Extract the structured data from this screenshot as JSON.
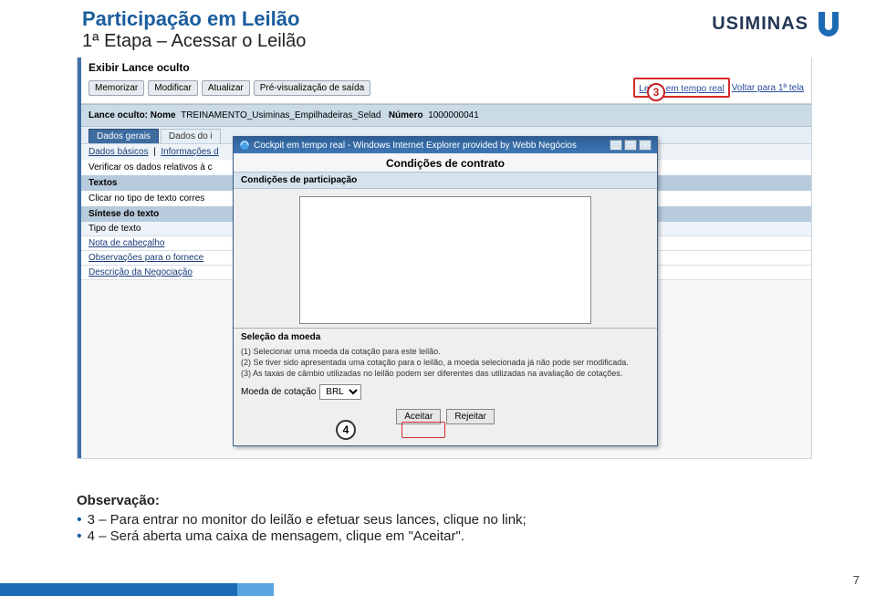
{
  "slide": {
    "title": "Participação em Leilão",
    "subtitle": "1ª Etapa – Acessar o Leilão",
    "page_number": "7"
  },
  "brand": {
    "name": "USIMINAS"
  },
  "callouts": {
    "three": "3",
    "four": "4"
  },
  "shot": {
    "top_heading": "Exibir Lance oculto",
    "buttons": {
      "memorize": "Memorizar",
      "modify": "Modificar",
      "refresh": "Atualizar",
      "preview": "Pré-visualização de saída"
    },
    "links": {
      "realtime": "Leilão em tempo real",
      "go_back": "Voltar para 1ª tela"
    },
    "info": {
      "prefix": "Lance oculto: Nome",
      "name_value": "TREINAMENTO_Usiminas_Empilhadeiras_Selad",
      "number_label": "Número",
      "number_value": "1000000041"
    },
    "tabs": {
      "dados_gerais": "Dados gerais",
      "dados_do": "Dados do i"
    },
    "subtabs": {
      "basicos": "Dados básicos",
      "informacoes": "Informações d"
    },
    "verify_line": "Verificar os dados relativos à c",
    "textos_label": "Textos",
    "textos_hint": "Clicar no tipo de texto corres",
    "sintese_label": "Síntese do texto",
    "side": {
      "tipo_texto": "Tipo de texto",
      "nota_cabecalho": "Nota de cabeçalho",
      "obs_fornece": "Observações para o fornece",
      "descr_negoc": "Descrição da Negociação"
    }
  },
  "popup": {
    "window_title": "Cockpit em tempo real - Windows Internet Explorer provided by Webb Negócios",
    "heading": "Condições de contrato",
    "subtab": "Condições de participação",
    "section": "Seleção da moeda",
    "instr1": "(1) Selecionar uma moeda da cotação para este leilão.",
    "instr2": "(2) Se tiver sido apresentada uma cotação para o leilão, a moeda selecionada já não pode ser modificada.",
    "instr3": "(3) As taxas de câmbio utilizadas no leilão podem ser diferentes das utilizadas na avaliação de cotações.",
    "currency_label": "Moeda de cotação",
    "currency_value": "BRL",
    "accept": "Aceitar",
    "reject": "Rejeitar",
    "winbtn_min": "_",
    "winbtn_max": "□",
    "winbtn_close": "×"
  },
  "obs": {
    "title": "Observação:",
    "b1": "3 – Para entrar no monitor do leilão e efetuar seus lances, clique no link;",
    "b2": "4 – Será aberta uma caixa de mensagem, clique em \"Aceitar\"."
  }
}
